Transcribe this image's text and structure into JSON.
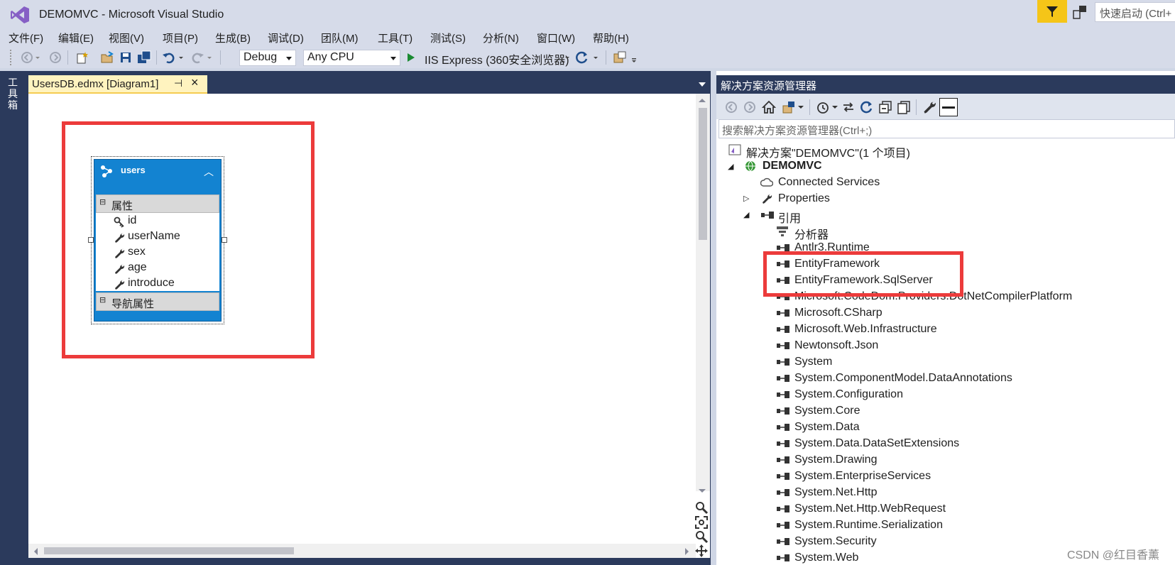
{
  "window": {
    "title": "DEMOMVC - Microsoft Visual Studio",
    "quick_launch_placeholder": "快速启动 (Ctrl+"
  },
  "menu": [
    "文件(F)",
    "编辑(E)",
    "视图(V)",
    "项目(P)",
    "生成(B)",
    "调试(D)",
    "团队(M)",
    "工具(T)",
    "测试(S)",
    "分析(N)",
    "窗口(W)",
    "帮助(H)"
  ],
  "toolbar": {
    "config": "Debug",
    "platform": "Any CPU",
    "run_label": "IIS Express (360安全浏览器)"
  },
  "left_dock": {
    "toolbox": "工具箱"
  },
  "document": {
    "tab_label": "UsersDB.edmx [Diagram1]",
    "entity": {
      "name": "users",
      "properties_header": "属性",
      "properties": [
        "id",
        "userName",
        "sex",
        "age",
        "introduce"
      ],
      "nav_header": "导航属性"
    }
  },
  "solution_explorer": {
    "title": "解决方案资源管理器",
    "search_placeholder": "搜索解决方案资源管理器(Ctrl+;)",
    "solution": "解决方案\"DEMOMVC\"(1 个项目)",
    "project": "DEMOMVC",
    "connected_services": "Connected Services",
    "properties": "Properties",
    "references": "引用",
    "analyzers": "分析器",
    "refs": [
      "Antlr3.Runtime",
      "EntityFramework",
      "EntityFramework.SqlServer",
      "Microsoft.CodeDom.Providers.DotNetCompilerPlatform",
      "Microsoft.CSharp",
      "Microsoft.Web.Infrastructure",
      "Newtonsoft.Json",
      "System",
      "System.ComponentModel.DataAnnotations",
      "System.Configuration",
      "System.Core",
      "System.Data",
      "System.Data.DataSetExtensions",
      "System.Drawing",
      "System.EnterpriseServices",
      "System.Net.Http",
      "System.Net.Http.WebRequest",
      "System.Runtime.Serialization",
      "System.Security",
      "System.Web"
    ]
  },
  "watermark": "CSDN @红目香薰",
  "colors": {
    "accent": "#1383d1",
    "highlight": "#ec3b3b",
    "dock": "#2b3a5c",
    "filter": "#f5c518"
  }
}
